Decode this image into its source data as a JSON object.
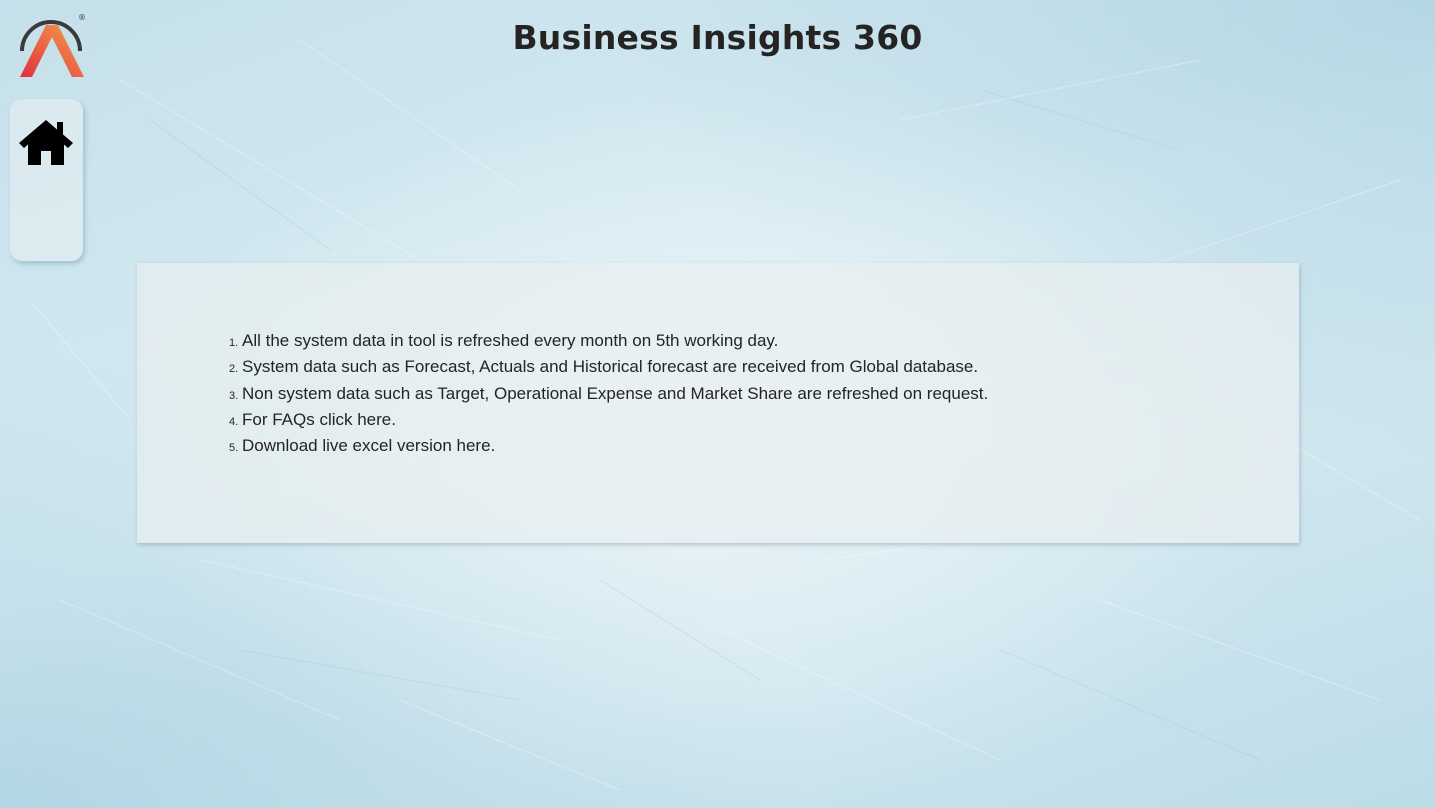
{
  "header": {
    "title": "Business Insights 360"
  },
  "logo": {
    "icon": "a-letter-logo-icon",
    "registered_mark": "®",
    "colors": {
      "gradient_start": "#f6a04d",
      "gradient_end": "#e0303d",
      "ring": "#3a3a3a"
    }
  },
  "nav": {
    "home": {
      "icon": "home-icon"
    }
  },
  "info": {
    "items": [
      {
        "num": "1.",
        "text": "All the system data in tool is refreshed every month on 5th working day."
      },
      {
        "num": "2.",
        "text": "System data such as Forecast, Actuals and Historical forecast are received from Global database."
      },
      {
        "num": "3.",
        "text": "Non system data such as Target, Operational Expense and Market Share are refreshed on request."
      },
      {
        "num": "4.",
        "text": "For FAQs click here."
      },
      {
        "num": "5.",
        "text": "Download live excel version here."
      }
    ]
  },
  "theme": {
    "background": "#cfe6ef",
    "text": "#252423"
  }
}
